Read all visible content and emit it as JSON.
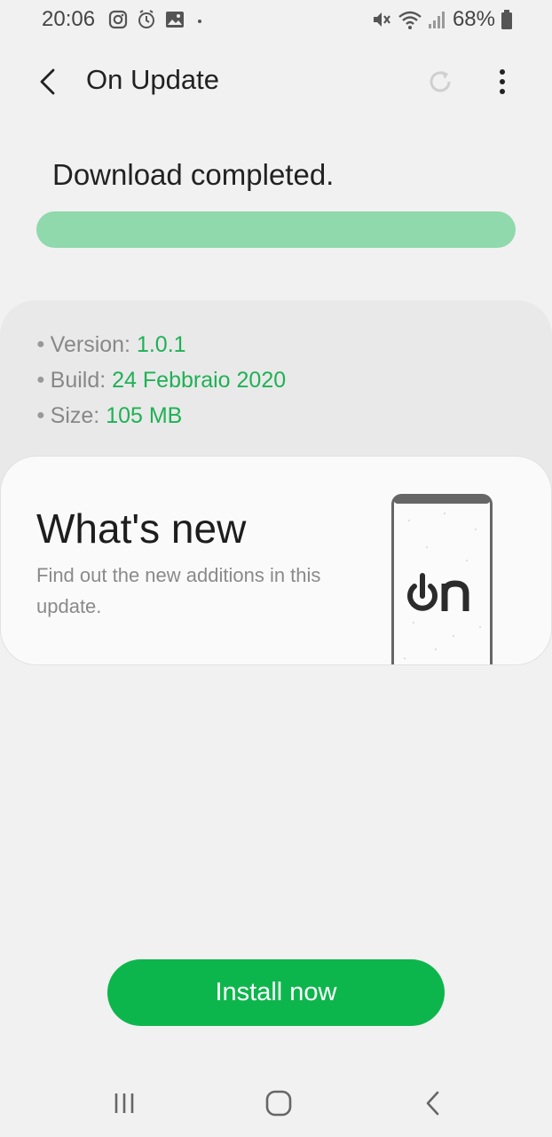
{
  "status_bar": {
    "time": "20:06",
    "left_icons": [
      "instagram-icon",
      "alarm-icon",
      "gallery-icon",
      "dot-icon"
    ],
    "right_icons": [
      "mute-icon",
      "wifi-icon",
      "signal-icon",
      "battery-icon"
    ],
    "battery": "68%"
  },
  "app_bar": {
    "title": "On Update",
    "back_icon": "back-arrow-icon",
    "refresh_icon": "refresh-icon",
    "more_icon": "more-vert-icon"
  },
  "download": {
    "status_text": "Download completed.",
    "progress": 1.0,
    "progress_color": "#8fd9ad"
  },
  "info": {
    "rows": [
      {
        "label": "Version: ",
        "value": "1.0.1"
      },
      {
        "label": "Build: ",
        "value": "24 Febbraio 2020"
      },
      {
        "label": "Size: ",
        "value": "105 MB"
      }
    ],
    "value_color": "#1fb155"
  },
  "whats_new": {
    "title": "What's new",
    "description": "Find out the new additions in this update."
  },
  "install": {
    "label": "Install now",
    "color": "#0db64c"
  },
  "nav_bar": {
    "icons": [
      "recents-icon",
      "home-icon",
      "back-icon"
    ]
  }
}
